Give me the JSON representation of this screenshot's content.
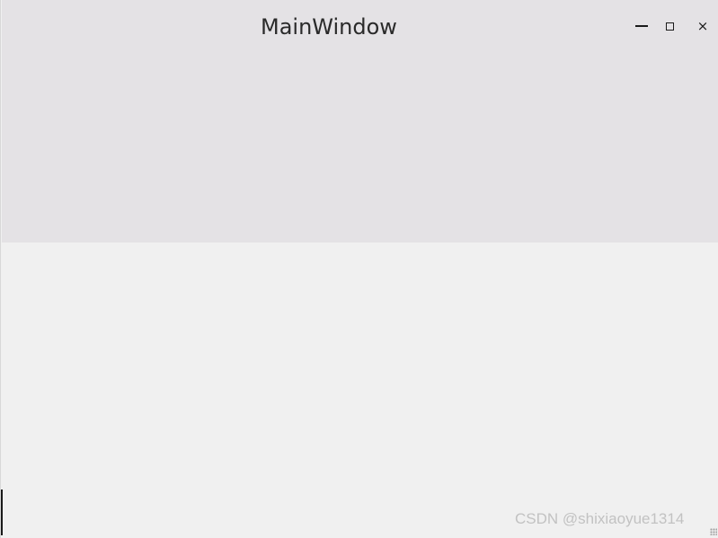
{
  "window": {
    "title": "MainWindow",
    "controls": {
      "minimize": "minimize",
      "maximize": "maximize",
      "close": "×"
    }
  },
  "watermark": {
    "text": "CSDN @shixiaoyue1314"
  },
  "colors": {
    "titlebar_bg": "#e4e2e5",
    "client_bg": "#f0f0f0",
    "title_text": "#2a2a2a",
    "watermark_text": "#c2c2c2"
  }
}
